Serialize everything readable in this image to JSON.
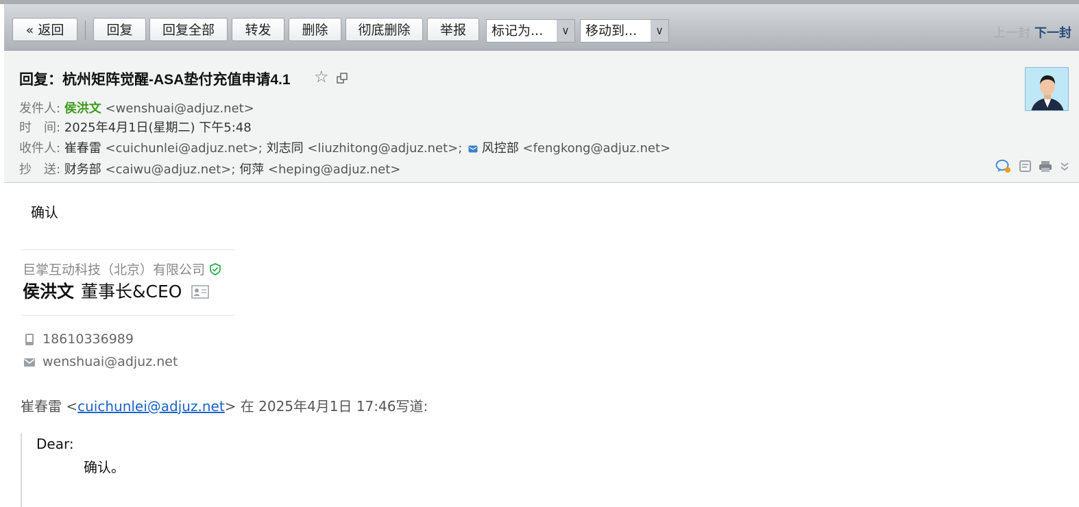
{
  "toolbar": {
    "back_label": "« 返回",
    "reply_label": "回复",
    "reply_all_label": "回复全部",
    "forward_label": "转发",
    "delete_label": "删除",
    "perm_delete_label": "彻底删除",
    "report_label": "举报",
    "mark_as_label": "标记为...",
    "move_to_label": "移动到...",
    "prev_label": "上一封",
    "next_label": "下一封"
  },
  "header": {
    "subject": "回复：杭州矩阵觉醒-ASA垫付充值申请4.1",
    "from_label": "发件人:",
    "from_name": "侯洪文",
    "from_email": "<wenshuai@adjuz.net>",
    "time_label": "时　间:",
    "time_value": "2025年4月1日(星期二) 下午5:48",
    "to_label": "收件人:",
    "to_1_name": "崔春雷",
    "to_1_email": "<cuichunlei@adjuz.net>;",
    "to_2_name": "刘志同",
    "to_2_email": "<liuzhitong@adjuz.net>;",
    "to_3_name": "风控部",
    "to_3_email": "<fengkong@adjuz.net>",
    "cc_label": "抄　送:",
    "cc_1_name": "财务部",
    "cc_1_email": "<caiwu@adjuz.net>;",
    "cc_2_name": "何萍",
    "cc_2_email": "<heping@adjuz.net>"
  },
  "body": {
    "reply_text": "确认",
    "signature": {
      "company": "巨掌互动科技（北京）有限公司",
      "name": "侯洪文",
      "title": "董事长&CEO",
      "phone": "18610336989",
      "email": "wenshuai@adjuz.net"
    },
    "quote": {
      "author_name": "崔春雷 <",
      "author_email": "cuichunlei@adjuz.net",
      "suffix": "> 在 2025年4月1日 17:46写道:",
      "greeting": "Dear:",
      "text": "确认。"
    }
  },
  "colors": {
    "sender_green": "#3c9b1d",
    "link_blue": "#1a62c9",
    "next_link": "#2a4d7a",
    "prev_disabled": "#a9adb2",
    "verified_green": "#2fae4a"
  }
}
